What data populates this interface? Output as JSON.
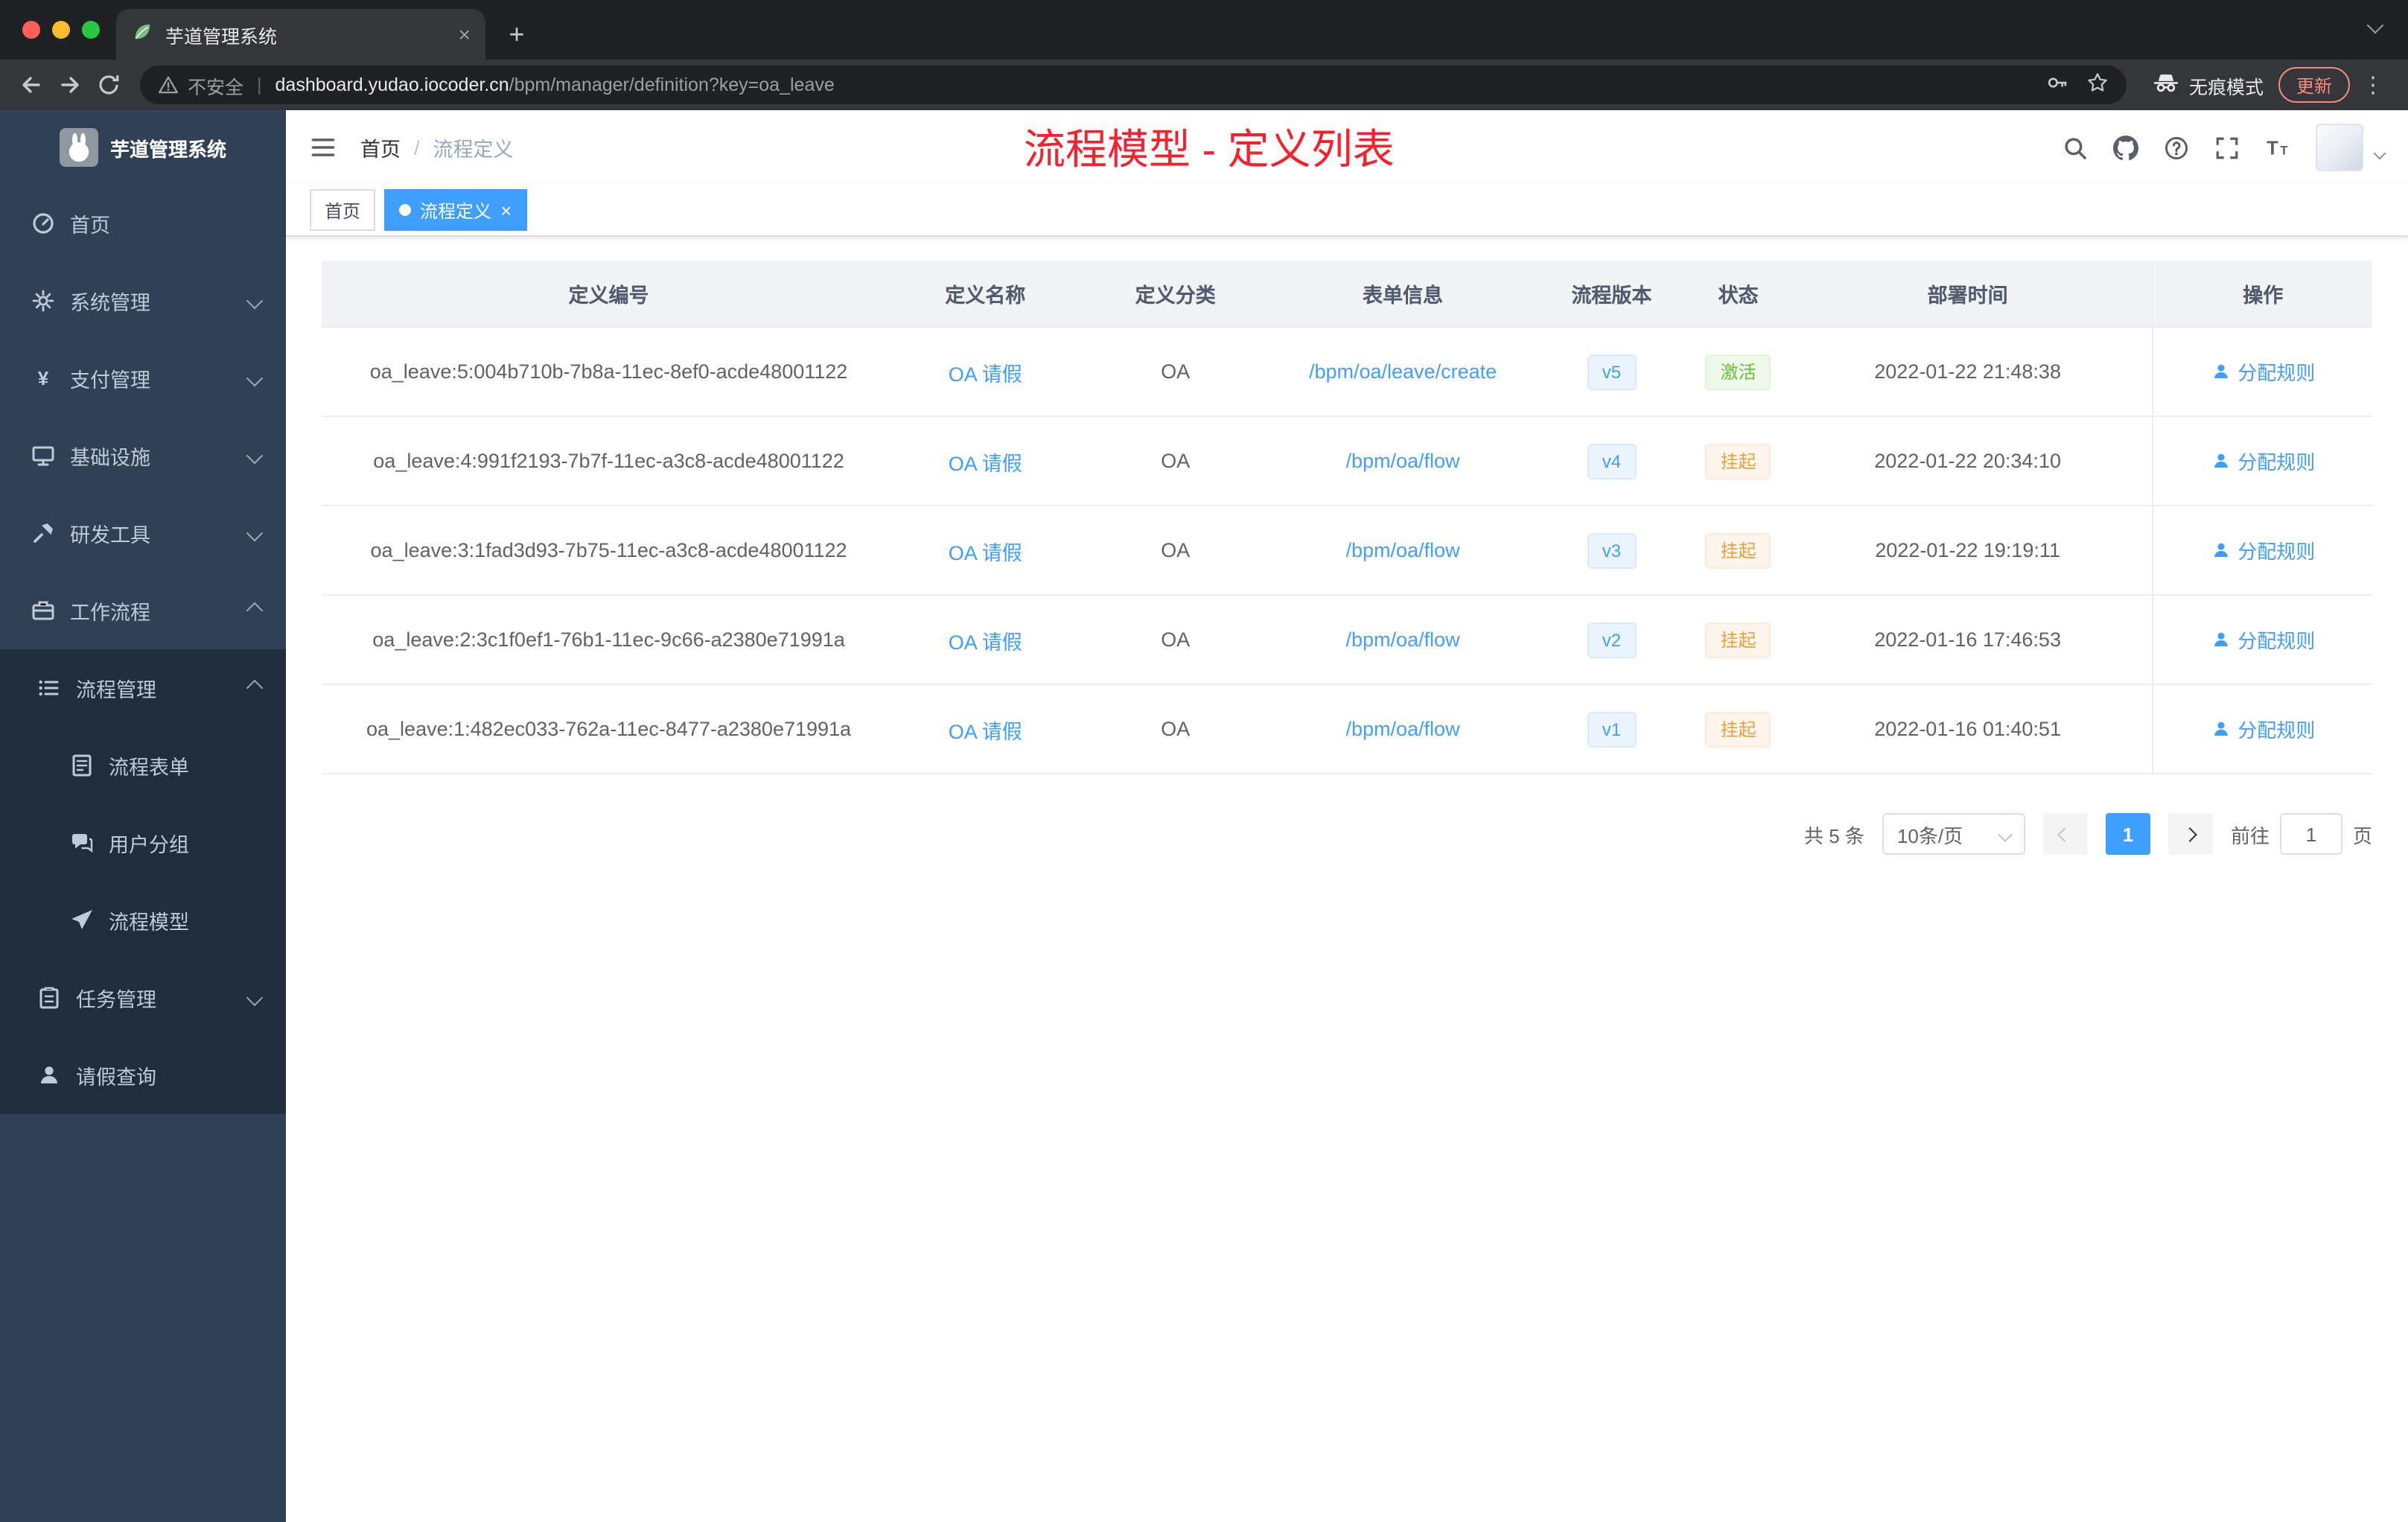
{
  "browser": {
    "tab_title": "芋道管理系统",
    "security_label": "不安全",
    "url_host": "dashboard.yudao.iocoder.cn",
    "url_path": "/bpm/manager/definition?key=oa_leave",
    "incognito_label": "无痕模式",
    "update_label": "更新",
    "traffic_colors": [
      "#ff5f57",
      "#febc2e",
      "#28c840"
    ]
  },
  "sidebar": {
    "brand": "芋道管理系统",
    "items": [
      {
        "label": "首页",
        "icon": "dashboard-icon",
        "level": 0,
        "arrow": "",
        "dark": false
      },
      {
        "label": "系统管理",
        "icon": "gear-icon",
        "level": 0,
        "arrow": "down",
        "dark": false
      },
      {
        "label": "支付管理",
        "icon": "yen-icon",
        "level": 0,
        "arrow": "down",
        "dark": false
      },
      {
        "label": "基础设施",
        "icon": "monitor-icon",
        "level": 0,
        "arrow": "down",
        "dark": false
      },
      {
        "label": "研发工具",
        "icon": "tool-icon",
        "level": 0,
        "arrow": "down",
        "dark": false
      },
      {
        "label": "工作流程",
        "icon": "briefcase-icon",
        "level": 0,
        "arrow": "up",
        "dark": false
      },
      {
        "label": "流程管理",
        "icon": "tree-icon",
        "level": 1,
        "arrow": "up",
        "dark": true
      },
      {
        "label": "流程表单",
        "icon": "form-icon",
        "level": 2,
        "arrow": "",
        "dark": true
      },
      {
        "label": "用户分组",
        "icon": "chat-icon",
        "level": 2,
        "arrow": "",
        "dark": true
      },
      {
        "label": "流程模型",
        "icon": "send-icon",
        "level": 2,
        "arrow": "",
        "dark": true
      },
      {
        "label": "任务管理",
        "icon": "task-icon",
        "level": 1,
        "arrow": "down",
        "dark": true
      },
      {
        "label": "请假查询",
        "icon": "user-icon",
        "level": 1,
        "arrow": "",
        "dark": true
      }
    ]
  },
  "header": {
    "breadcrumb": {
      "root": "首页",
      "separator": "/",
      "current": "流程定义"
    },
    "annotation": "流程模型 - 定义列表"
  },
  "tags": [
    {
      "label": "首页",
      "active": false
    },
    {
      "label": "流程定义",
      "active": true
    }
  ],
  "table": {
    "columns": [
      "定义编号",
      "定义名称",
      "定义分类",
      "表单信息",
      "流程版本",
      "状态",
      "部署时间",
      "操作"
    ],
    "rows": [
      {
        "id": "oa_leave:5:004b710b-7b8a-11ec-8ef0-acde48001122",
        "name": "OA 请假",
        "category": "OA",
        "form": "/bpm/oa/leave/create",
        "version": "v5",
        "status": "激活",
        "status_type": "success",
        "deploy_time": "2022-01-22 21:48:38",
        "action": "分配规则"
      },
      {
        "id": "oa_leave:4:991f2193-7b7f-11ec-a3c8-acde48001122",
        "name": "OA 请假",
        "category": "OA",
        "form": "/bpm/oa/flow",
        "version": "v4",
        "status": "挂起",
        "status_type": "warning",
        "deploy_time": "2022-01-22 20:34:10",
        "action": "分配规则"
      },
      {
        "id": "oa_leave:3:1fad3d93-7b75-11ec-a3c8-acde48001122",
        "name": "OA 请假",
        "category": "OA",
        "form": "/bpm/oa/flow",
        "version": "v3",
        "status": "挂起",
        "status_type": "warning",
        "deploy_time": "2022-01-22 19:19:11",
        "action": "分配规则"
      },
      {
        "id": "oa_leave:2:3c1f0ef1-76b1-11ec-9c66-a2380e71991a",
        "name": "OA 请假",
        "category": "OA",
        "form": "/bpm/oa/flow",
        "version": "v2",
        "status": "挂起",
        "status_type": "warning",
        "deploy_time": "2022-01-16 17:46:53",
        "action": "分配规则"
      },
      {
        "id": "oa_leave:1:482ec033-762a-11ec-8477-a2380e71991a",
        "name": "OA 请假",
        "category": "OA",
        "form": "/bpm/oa/flow",
        "version": "v1",
        "status": "挂起",
        "status_type": "warning",
        "deploy_time": "2022-01-16 01:40:51",
        "action": "分配规则"
      }
    ]
  },
  "pagination": {
    "total": "共 5 条",
    "page_size": "10条/页",
    "page": "1",
    "goto_prefix": "前往",
    "goto_value": "1",
    "goto_suffix": "页"
  }
}
